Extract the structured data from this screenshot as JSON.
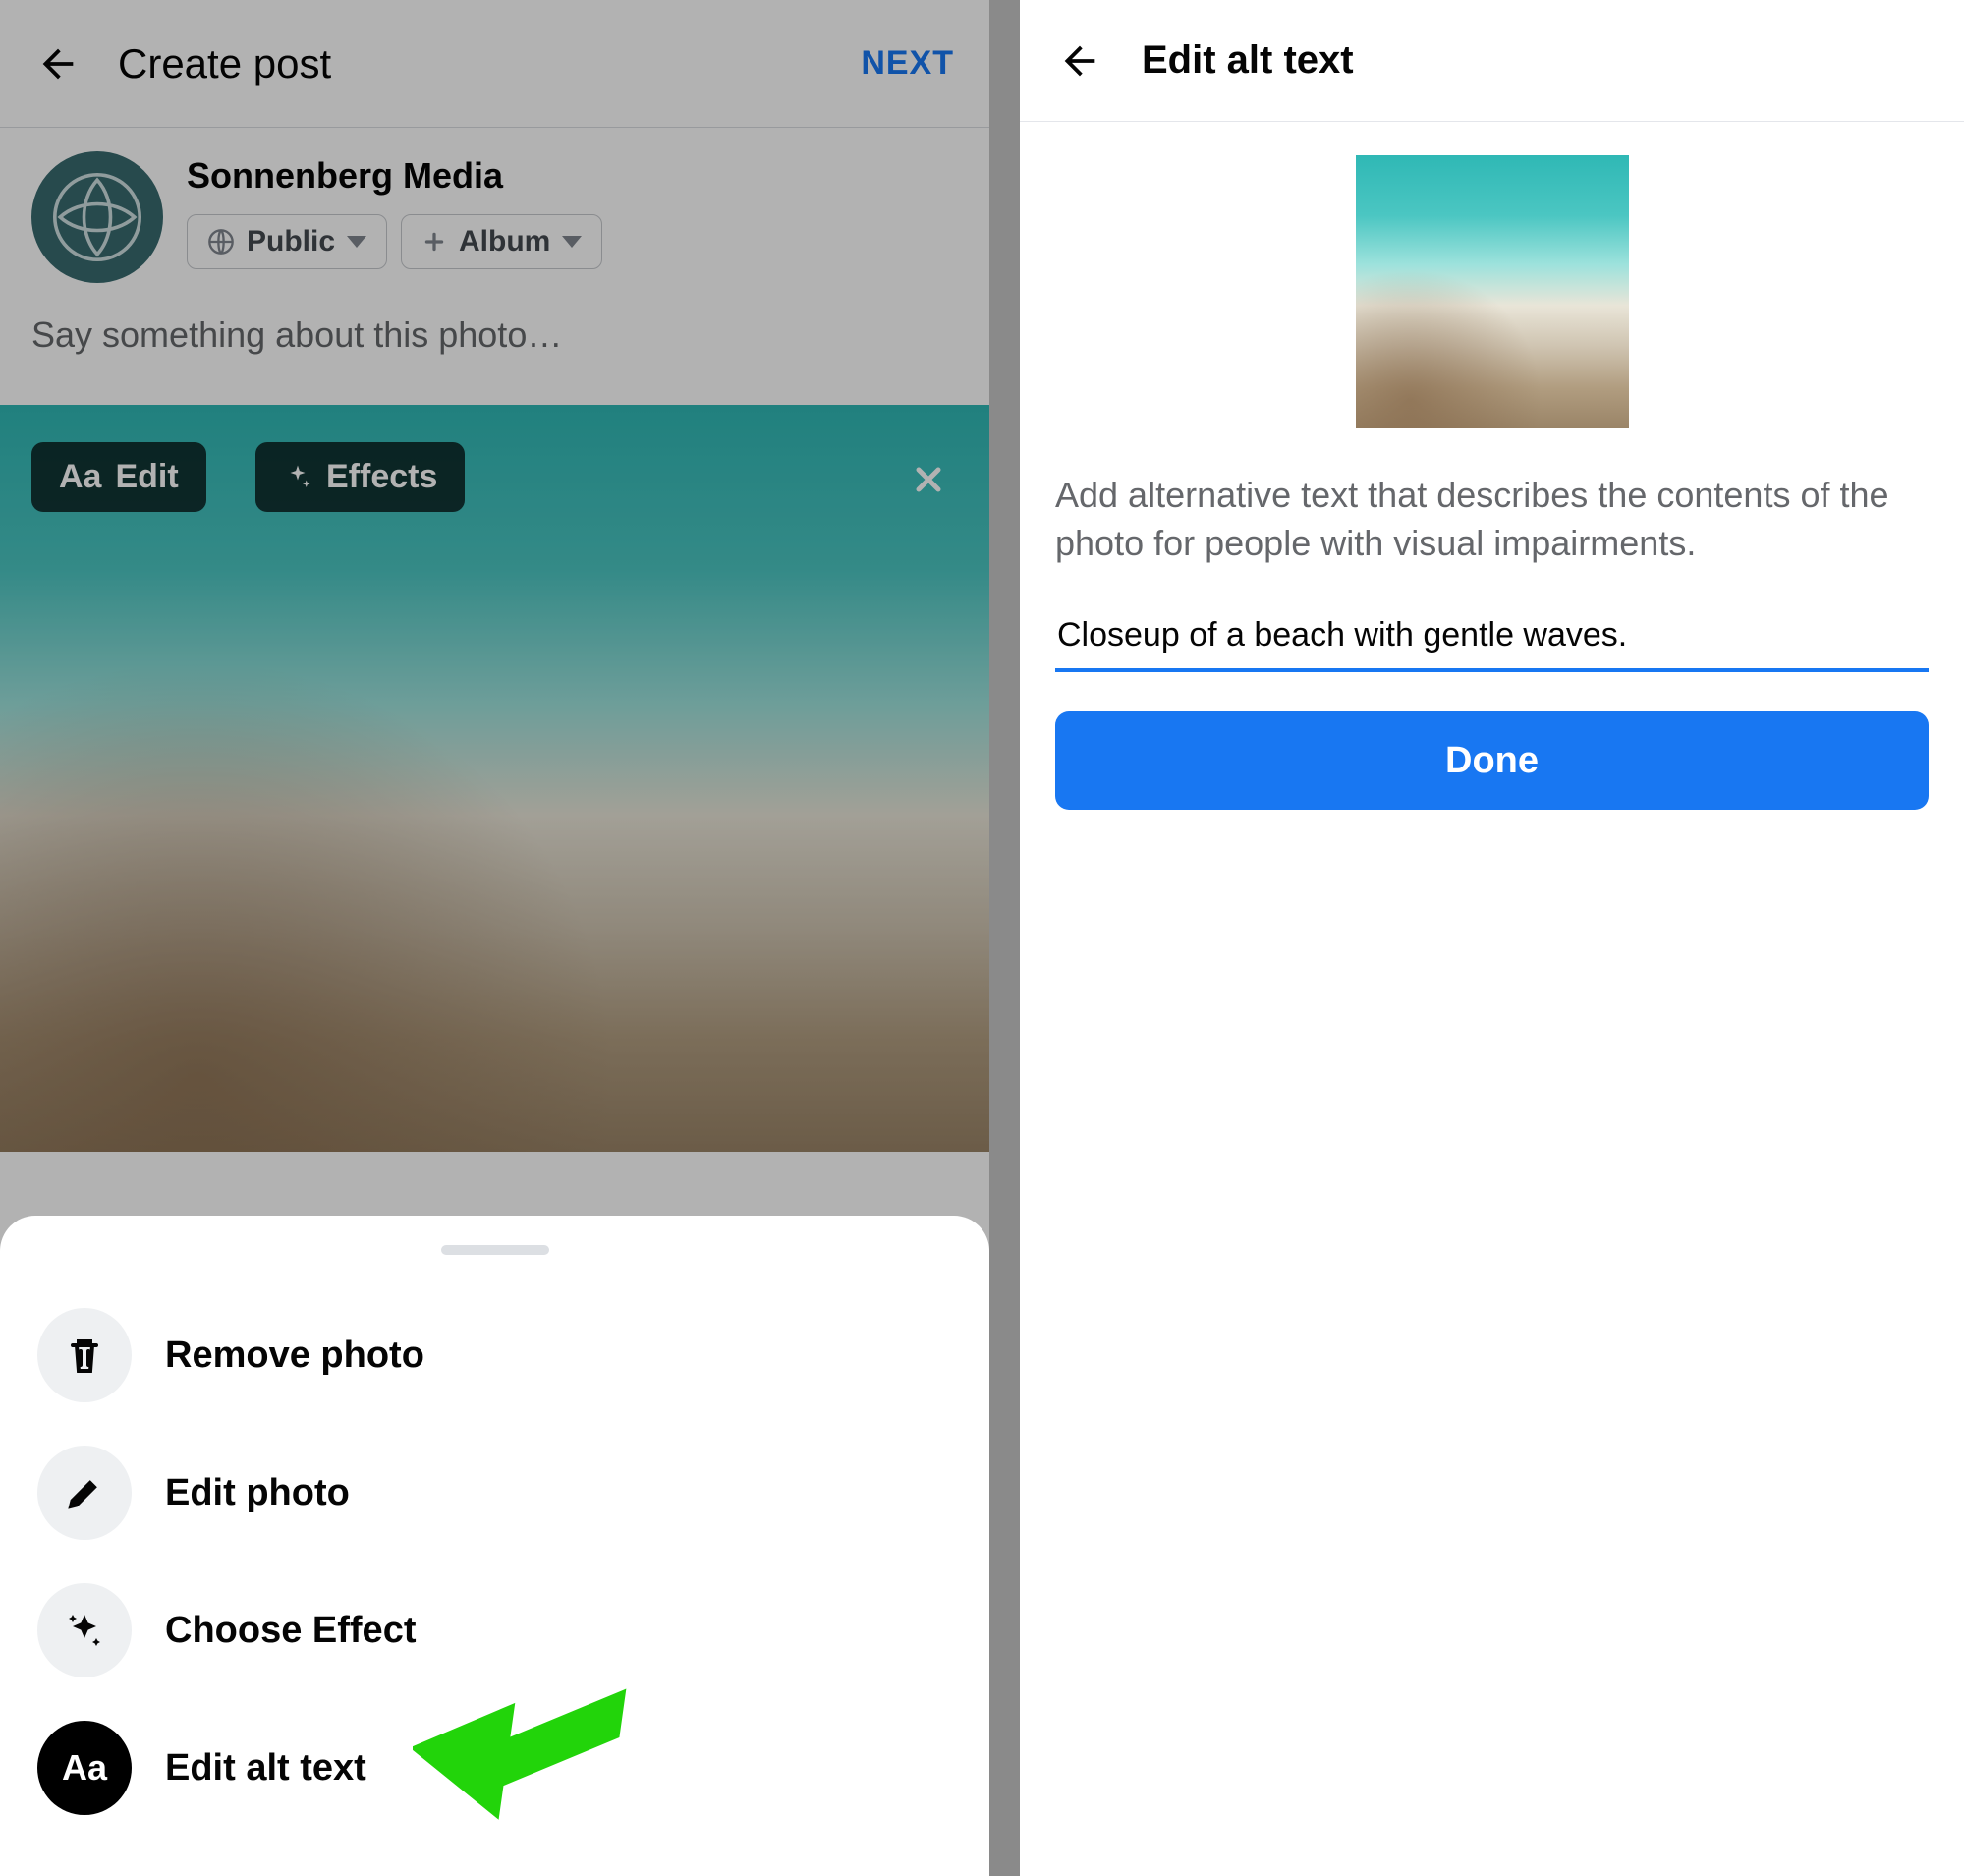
{
  "left": {
    "header": {
      "title": "Create post",
      "next": "NEXT"
    },
    "user": {
      "name": "Sonnenberg Media",
      "audience_label": "Public",
      "album_label": "Album"
    },
    "composer_placeholder": "Say something about this photo…",
    "photo_buttons": {
      "edit": "Edit",
      "effects": "Effects"
    },
    "sheet": {
      "remove": "Remove photo",
      "edit_photo": "Edit photo",
      "choose_effect": "Choose Effect",
      "edit_alt": "Edit alt text"
    }
  },
  "right": {
    "title": "Edit alt text",
    "description": "Add alternative text that describes the contents of the photo for people with visual impairments.",
    "alt_text_value": "Closeup of a beach with gentle waves.",
    "done": "Done"
  }
}
